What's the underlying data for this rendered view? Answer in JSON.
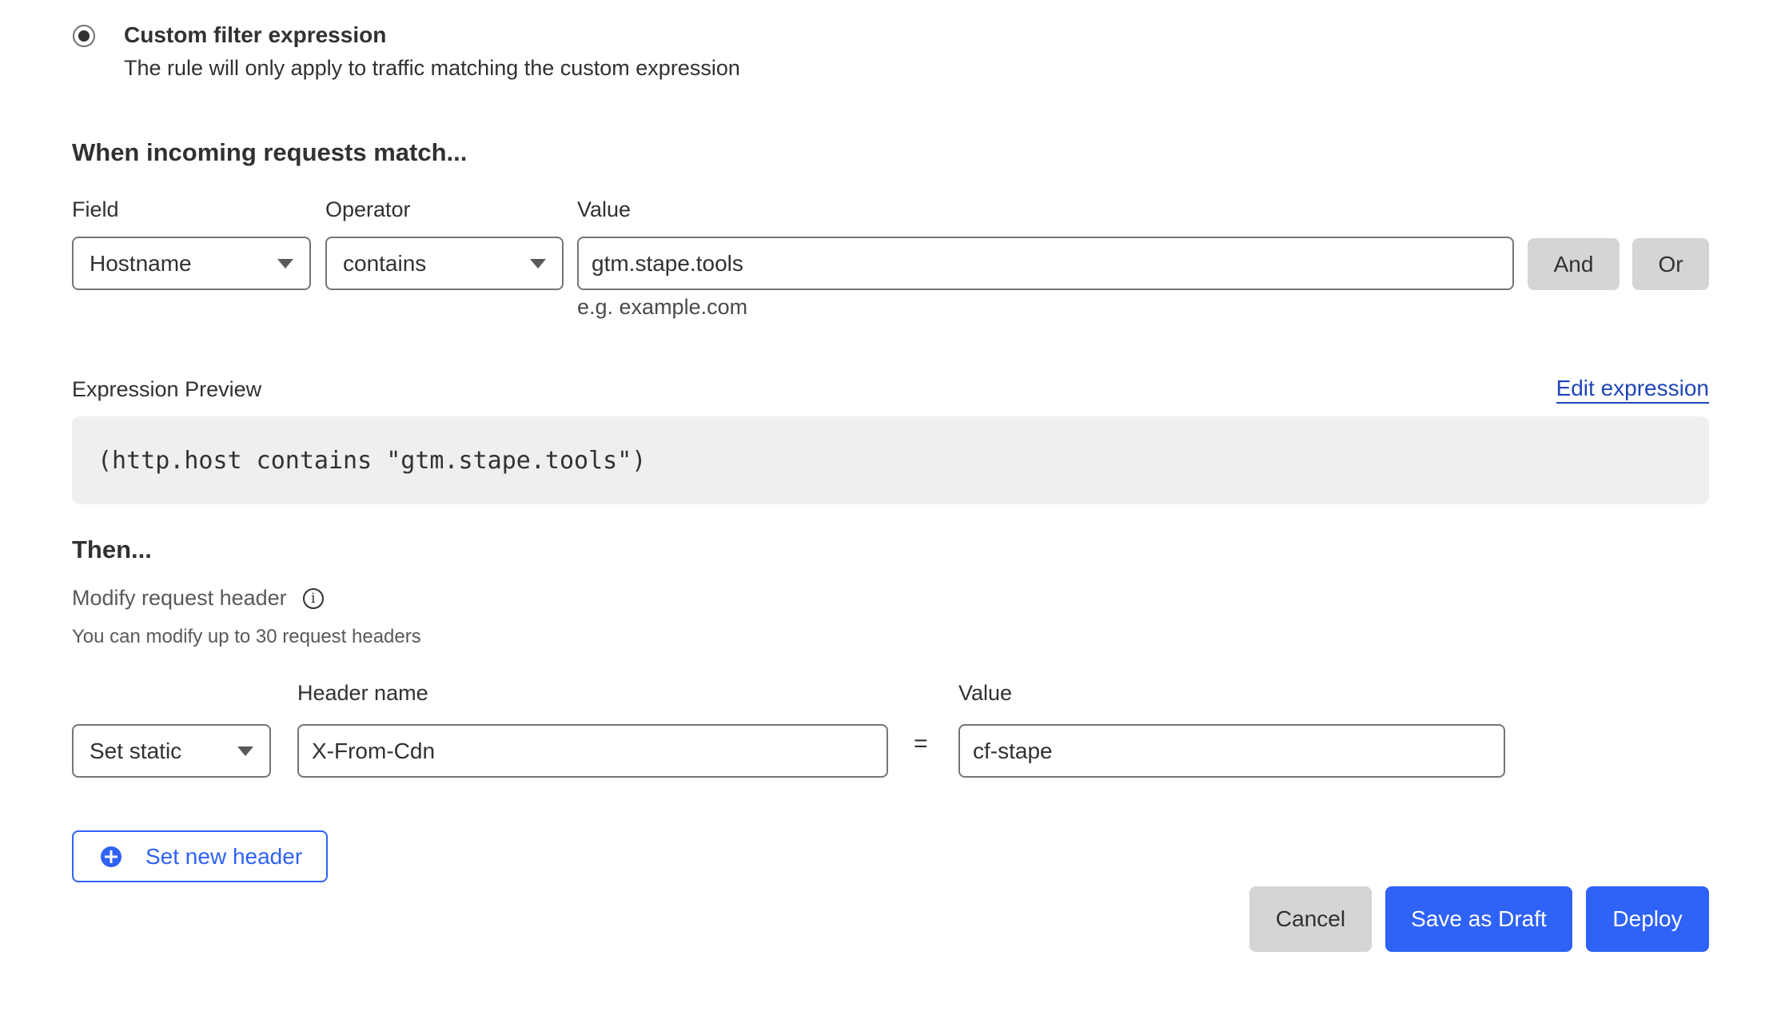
{
  "scope": {
    "option_title": "Custom filter expression",
    "option_description": "The rule will only apply to traffic matching the custom expression",
    "selected": true
  },
  "match": {
    "title": "When incoming requests match...",
    "field_label": "Field",
    "operator_label": "Operator",
    "value_label": "Value",
    "field_value": "Hostname",
    "operator_value": "contains",
    "value_input": "gtm.stape.tools",
    "value_hint": "e.g. example.com",
    "and_label": "And",
    "or_label": "Or"
  },
  "expression": {
    "label": "Expression Preview",
    "edit_link": "Edit expression",
    "code": "(http.host contains \"gtm.stape.tools\")"
  },
  "then": {
    "title": "Then...",
    "action_label": "Modify request header",
    "action_hint": "You can modify up to 30 request headers",
    "header_name_label": "Header name",
    "value_label": "Value",
    "operation_value": "Set static",
    "header_name_value": "X-From-Cdn",
    "equals_sign": "=",
    "header_value": "cf-stape",
    "add_header_label": "Set new header"
  },
  "footer": {
    "cancel_label": "Cancel",
    "save_draft_label": "Save as Draft",
    "deploy_label": "Deploy"
  },
  "colors": {
    "primary": "#2f62f6",
    "link": "#1f46b8",
    "secondary_button": "#d5d5d5",
    "code_background": "#efefef"
  }
}
